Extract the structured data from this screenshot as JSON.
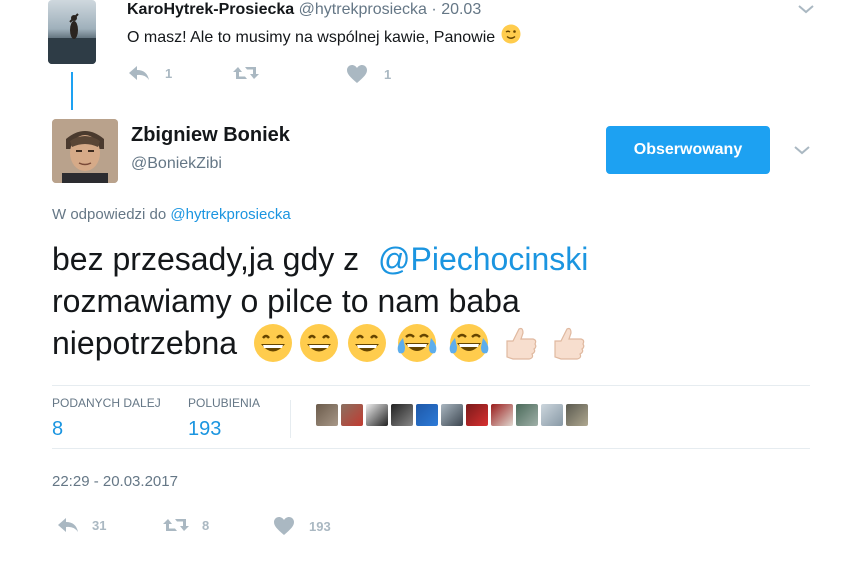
{
  "parent_tweet": {
    "display_name": "KaroHytrek-Prosiecka",
    "handle": "@hytrekprosiecka",
    "separator": "·",
    "date": "20.03",
    "text": "O masz! Ale to musimy na wspólnej kawie, Panowie",
    "reply_count": "1",
    "like_count": "1"
  },
  "main_tweet": {
    "display_name": "Zbigniew Boniek",
    "handle": "@BoniekZibi",
    "follow_button": "Obserwowany",
    "reply_prefix": "W odpowiedzi do",
    "reply_to": "@hytrekprosiecka",
    "text_part1": "bez przesady,ja gdy z ",
    "mention": "@Piechocinski",
    "text_part2": "rozmawiamy o pilce to nam baba",
    "text_part3": "niepotrzebna",
    "stats": {
      "retweets_label": "PODANYCH DALEJ",
      "retweets_value": "8",
      "likes_label": "POLUBIENIA",
      "likes_value": "193"
    },
    "timestamp": "22:29 - 20.03.2017",
    "actions": {
      "reply": "31",
      "retweet": "8",
      "like": "193"
    }
  },
  "icons": [
    "reply-icon",
    "retweet-icon",
    "heart-icon",
    "chevron-down-icon",
    "wink-emoji",
    "grin-emoji",
    "tears-of-joy-emoji",
    "thumbs-up-emoji"
  ],
  "colors": {
    "accent": "#1b95e0",
    "muted": "#657786",
    "action_gray": "#aab8c2",
    "divider": "#e6ecf0"
  }
}
